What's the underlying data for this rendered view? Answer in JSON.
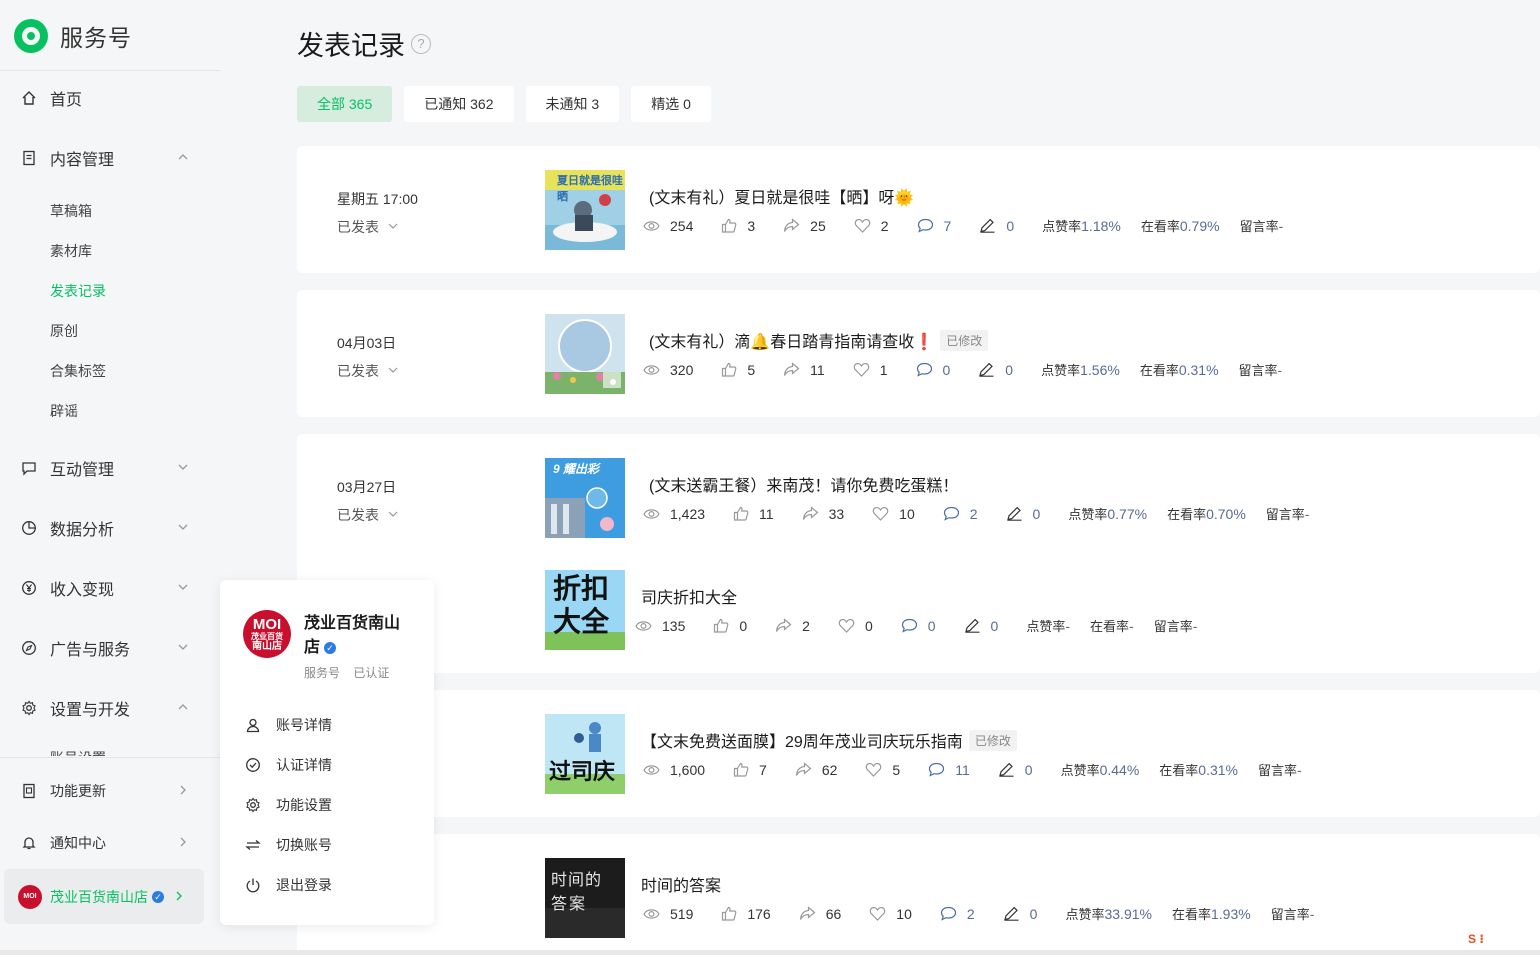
{
  "app": {
    "title": "服务号"
  },
  "sidebar": {
    "home": "首页",
    "content": "内容管理",
    "content_items": [
      "草稿箱",
      "素材库",
      "发表记录",
      "原创",
      "合集标签",
      "辟谣"
    ],
    "interaction": "互动管理",
    "analytics": "数据分析",
    "monetize": "收入变现",
    "ads": "广告与服务",
    "settings": "设置与开发",
    "settings_peek": "账号设置",
    "updates": "功能更新",
    "notifications": "通知中心",
    "account_name": "茂业百货南山店"
  },
  "popup": {
    "name": "茂业百货南山店",
    "avatar_text_1": "MOI",
    "avatar_text_2": "茂业百货",
    "avatar_text_3": "南山店",
    "type": "服务号",
    "verified": "已认证",
    "menu": [
      "账号详情",
      "认证详情",
      "功能设置",
      "切换账号",
      "退出登录"
    ]
  },
  "main": {
    "title": "发表记录",
    "tabs": [
      "全部 365",
      "已通知 362",
      "未通知 3",
      "精选 0"
    ],
    "labels": {
      "like_rate": "点赞率",
      "watch_rate": "在看率",
      "comment_rate": "留言率",
      "modified": "已修改",
      "published": "已发表"
    },
    "posts": [
      {
        "date": "星期五 17:00",
        "title": "(文末有礼）夏日就是很哇【晒】呀🌞",
        "modified": false,
        "views": "254",
        "likes": "3",
        "shares": "25",
        "hearts": "2",
        "comments": "7",
        "edits": "0",
        "like_rate": "1.18%",
        "watch_rate": "0.79%",
        "comment_rate": "-"
      },
      {
        "date": "04月03日",
        "title": "(文末有礼）滴🔔春日踏青指南请查收❗",
        "modified": true,
        "views": "320",
        "likes": "5",
        "shares": "11",
        "hearts": "1",
        "comments": "0",
        "edits": "0",
        "like_rate": "1.56%",
        "watch_rate": "0.31%",
        "comment_rate": "-"
      },
      {
        "date": "03月27日",
        "title": "(文末送霸王餐）来南茂！请你免费吃蛋糕！",
        "modified": false,
        "views": "1,423",
        "likes": "11",
        "shares": "33",
        "hearts": "10",
        "comments": "2",
        "edits": "0",
        "like_rate": "0.77%",
        "watch_rate": "0.70%",
        "comment_rate": "-"
      },
      {
        "date": "",
        "title": "司庆折扣大全",
        "modified": false,
        "views": "135",
        "likes": "0",
        "shares": "2",
        "hearts": "0",
        "comments": "0",
        "edits": "0",
        "like_rate": "-",
        "watch_rate": "-",
        "comment_rate": "-"
      },
      {
        "date": "",
        "title": "【文末免费送面膜】29周年茂业司庆玩乐指南",
        "modified": true,
        "views": "1,600",
        "likes": "7",
        "shares": "62",
        "hearts": "5",
        "comments": "11",
        "edits": "0",
        "like_rate": "0.44%",
        "watch_rate": "0.31%",
        "comment_rate": "-"
      },
      {
        "date": "",
        "title": "时间的答案",
        "modified": false,
        "views": "519",
        "likes": "176",
        "shares": "66",
        "hearts": "10",
        "comments": "2",
        "edits": "0",
        "like_rate": "33.91%",
        "watch_rate": "1.93%",
        "comment_rate": "-"
      }
    ],
    "thumb_text": {
      "t1": "夏日就是很哇晒",
      "t3": "9 耀出彩",
      "t4a": "折扣",
      "t4b": "大全",
      "t5": "过司庆",
      "t6a": "时间的",
      "t6b": "答案"
    }
  },
  "colors": {
    "accent": "#07c160",
    "rate_blue": "#576b95"
  }
}
